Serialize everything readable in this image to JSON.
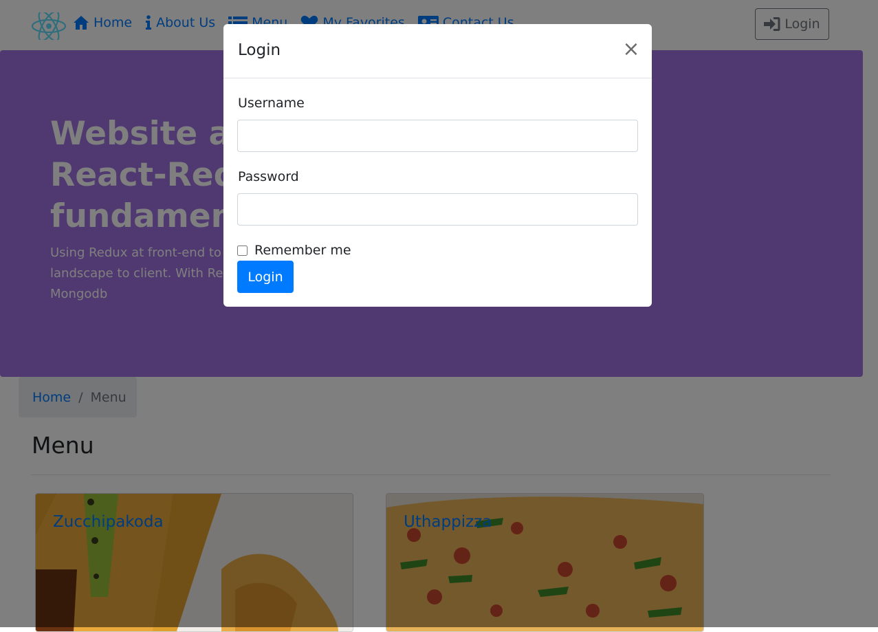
{
  "nav": {
    "brand_icon": "react-logo-icon",
    "items": [
      {
        "label": "Home",
        "icon": "home-icon"
      },
      {
        "label": "About Us",
        "icon": "info-icon"
      },
      {
        "label": "Menu",
        "icon": "list-icon"
      },
      {
        "label": "My Favorites",
        "icon": "heart-icon"
      },
      {
        "label": "Contact Us",
        "icon": "address-card-icon"
      }
    ],
    "login_label": "Login",
    "login_icon": "sign-in-icon"
  },
  "jumbotron": {
    "title_lines": [
      "Website ap",
      "React-Redu",
      "fundament"
    ],
    "text_lines": [
      "Using Redux at front-end to",
      "landscape to client. With Res",
      "Mongodb"
    ]
  },
  "breadcrumb": {
    "home": "Home",
    "separator": "/",
    "active": "Menu"
  },
  "menu": {
    "heading": "Menu",
    "cards": [
      {
        "title": "Zucchipakoda"
      },
      {
        "title": "Uthappizza"
      }
    ]
  },
  "modal": {
    "title": "Login",
    "close_glyph": "×",
    "username_label": "Username",
    "username_value": "",
    "password_label": "Password",
    "password_value": "",
    "remember_label": "Remember me",
    "remember_checked": false,
    "submit_label": "Login"
  },
  "colors": {
    "link": "#007bff",
    "jumbotron_bg": "#9f73e0",
    "primary_button": "#007bff",
    "backdrop": "rgba(0,0,0,0.5)"
  }
}
